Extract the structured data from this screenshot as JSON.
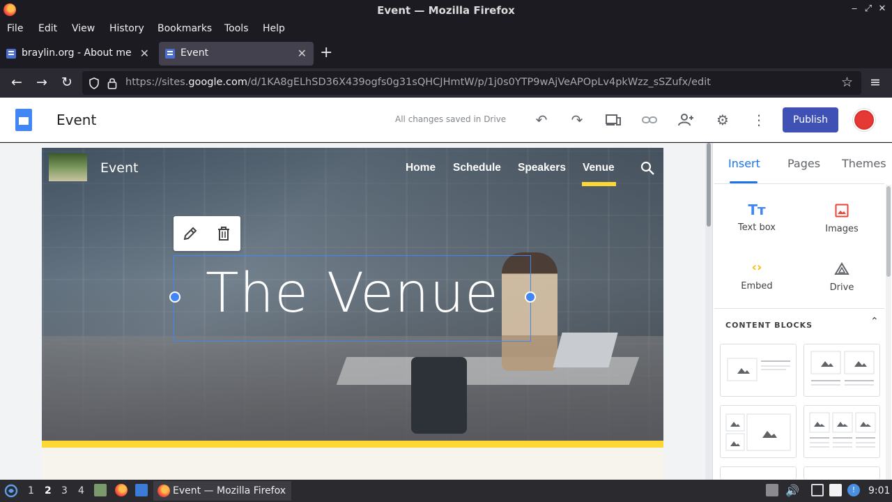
{
  "window": {
    "title": "Event — Mozilla Firefox"
  },
  "menubar": {
    "items": [
      "File",
      "Edit",
      "View",
      "History",
      "Bookmarks",
      "Tools",
      "Help"
    ]
  },
  "tabs": [
    {
      "label": "braylin.org - About me"
    },
    {
      "label": "Event"
    }
  ],
  "urlbar": {
    "prefix": "https://sites.",
    "domain": "google.com",
    "path": "/d/1KA8gELhSD36X439ogfs0g31sQHCJHmtW/p/1j0s0YTP9wAjVeAPOpLv4pkWzz_sSZufx/edit"
  },
  "sites_header": {
    "doc_title": "Event",
    "save_status": "All changes saved in Drive",
    "publish_label": "Publish"
  },
  "site": {
    "name": "Event",
    "nav": [
      "Home",
      "Schedule",
      "Speakers",
      "Venue"
    ],
    "active_nav": "Venue",
    "hero_title": "The Venue",
    "accent_color": "#fdd835"
  },
  "panel": {
    "tabs": [
      "Insert",
      "Pages",
      "Themes"
    ],
    "active_tab": "Insert",
    "insert_items": [
      {
        "label": "Text box",
        "icon": "text-box-icon"
      },
      {
        "label": "Images",
        "icon": "image-icon"
      },
      {
        "label": "Embed",
        "icon": "embed-icon"
      },
      {
        "label": "Drive",
        "icon": "drive-icon"
      }
    ],
    "content_blocks_heading": "CONTENT BLOCKS"
  },
  "taskbar": {
    "workspaces": [
      "1",
      "2",
      "3",
      "4"
    ],
    "active_workspace": "2",
    "app_label": "Event — Mozilla Firefox",
    "clock": "9:01"
  }
}
